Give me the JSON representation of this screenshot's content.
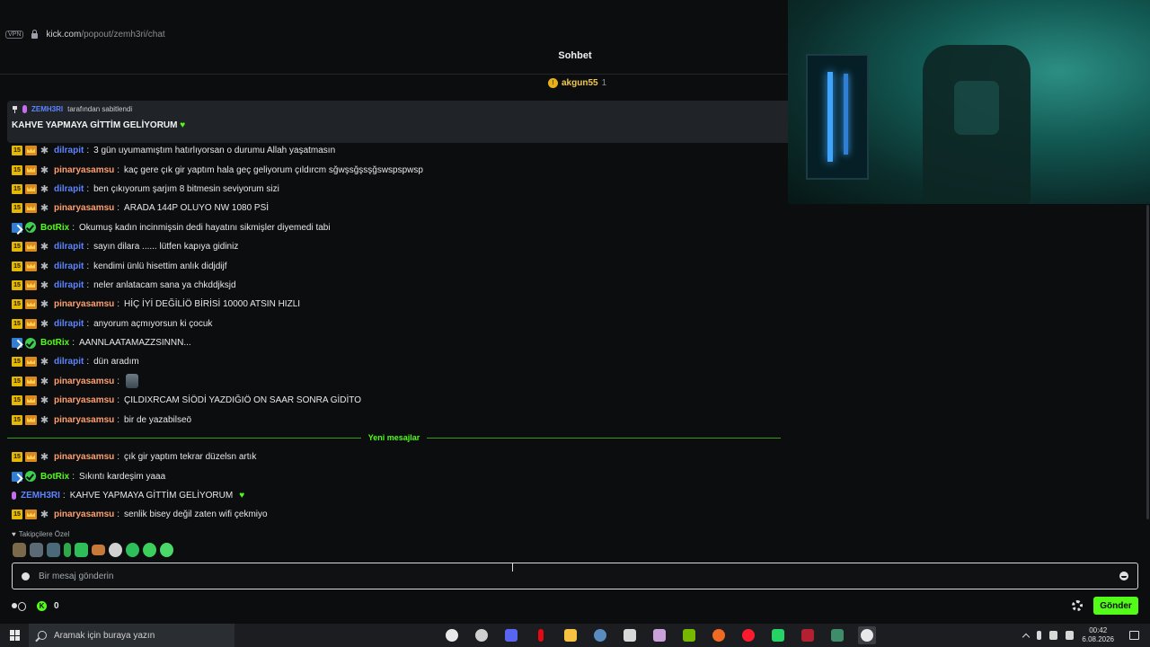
{
  "browser": {
    "vpn_label": "VPN",
    "url_host": "kick.com",
    "url_path": "/popout/zemh3ri/chat"
  },
  "chat": {
    "title": "Sohbet",
    "top_gifter": {
      "name": "akgun55",
      "count": "1"
    },
    "pinned": {
      "by_user": "ZEMH3RI",
      "by_suffix": "tarafından sabitlendi",
      "message": "KAHVE YAPMAYA GİTTİM GELİYORUM"
    },
    "messages": [
      {
        "badges": [
          "15",
          "crown",
          "star"
        ],
        "user": "dilrapit",
        "color": "blue",
        "text": "3 gün uyumamıştım hatırlıyorsan o durumu Allah yaşatmasın"
      },
      {
        "badges": [
          "15",
          "crown",
          "star"
        ],
        "user": "pinaryasamsu",
        "color": "orange",
        "text": "kaç gere çık gir yaptım hala geç geliyorum çıldırcm sğwşsğşsşğswspspwsp"
      },
      {
        "badges": [
          "15",
          "crown",
          "star"
        ],
        "user": "dilrapit",
        "color": "blue",
        "text": "ben çıkıyorum şarjım 8 bitmesin seviyorum sizi"
      },
      {
        "badges": [
          "15",
          "crown",
          "star"
        ],
        "user": "pinaryasamsu",
        "color": "orange",
        "text": "ARADA 144P OLUYO NW 1080 PSİ"
      },
      {
        "badges": [
          "mod",
          "verified"
        ],
        "user": "BotRix",
        "color": "green",
        "text": "Okumuş kadın incinmişsin dedi hayatını sikmişler diyemedi tabi"
      },
      {
        "badges": [
          "15",
          "crown",
          "star"
        ],
        "user": "dilrapit",
        "color": "blue",
        "text": "sayın dilara ...... lütfen kapıya gidiniz"
      },
      {
        "badges": [
          "15",
          "crown",
          "star"
        ],
        "user": "dilrapit",
        "color": "blue",
        "text": "kendimi ünlü hisettim anlık didjdijf"
      },
      {
        "badges": [
          "15",
          "crown",
          "star"
        ],
        "user": "dilrapit",
        "color": "blue",
        "text": "neler anlatacam sana ya chkddjksjd"
      },
      {
        "badges": [
          "15",
          "crown",
          "star"
        ],
        "user": "pinaryasamsu",
        "color": "orange",
        "text": "HİÇ İYİ DEĞİLİÖ BİRİSİ 10000 ATSIN HIZLI"
      },
      {
        "badges": [
          "15",
          "crown",
          "star"
        ],
        "user": "dilrapit",
        "color": "blue",
        "text": "anyorum açmıyorsun ki çocuk"
      },
      {
        "badges": [
          "mod",
          "verified"
        ],
        "user": "BotRix",
        "color": "green",
        "text": "AANNLAATAMAZZSINNN..."
      },
      {
        "badges": [
          "15",
          "crown",
          "star"
        ],
        "user": "dilrapit",
        "color": "blue",
        "text": "dün aradım"
      },
      {
        "badges": [
          "15",
          "crown",
          "star"
        ],
        "user": "pinaryasamsu",
        "color": "orange",
        "text": "",
        "emote": true
      },
      {
        "badges": [
          "15",
          "crown",
          "star"
        ],
        "user": "pinaryasamsu",
        "color": "orange",
        "text": "ÇILDIXRCAM SİÖDİ YAZDIĞIÖ ON SAAR SONRA GİDİTO"
      },
      {
        "badges": [
          "15",
          "crown",
          "star"
        ],
        "user": "pinaryasamsu",
        "color": "orange",
        "text": "bir de yazabilseö"
      }
    ],
    "new_messages_label": "Yeni mesajlar",
    "new_messages": [
      {
        "badges": [
          "15",
          "crown",
          "star"
        ],
        "user": "pinaryasamsu",
        "color": "orange",
        "text": "çık gir yaptım tekrar düzelsn artık"
      },
      {
        "badges": [
          "mod",
          "verified"
        ],
        "user": "BotRix",
        "color": "green",
        "text": "Sıkıntı kardeşim yaaa"
      },
      {
        "badges": [
          "mic"
        ],
        "user": "ZEMH3RI",
        "color": "owner",
        "text": "KAHVE YAPMAYA GİTTİM GELİYORUM",
        "heart": true
      },
      {
        "badges": [
          "15",
          "crown",
          "star"
        ],
        "user": "pinaryasamsu",
        "color": "orange",
        "text": "senlik bisey değil zaten wifi çekmiyo"
      }
    ],
    "subscriber_emotes_label": "Takipçilere Özel",
    "input_placeholder": "Bir mesaj gönderin",
    "points": "0",
    "send_label": "Gönder"
  },
  "taskbar": {
    "search_placeholder": "Aramak için buraya yazın",
    "time": "00:42",
    "date": "6.08.2026"
  },
  "colors": {
    "accent": "#53fc18",
    "user_blue": "#5e84ff",
    "user_orange": "#ff9f6e"
  }
}
